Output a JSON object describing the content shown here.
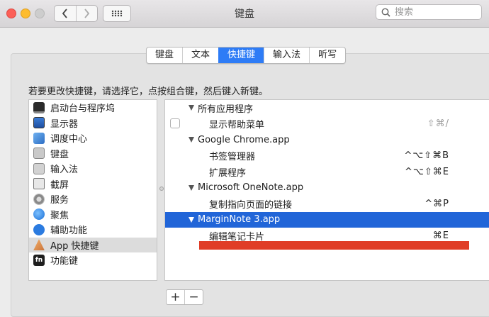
{
  "window": {
    "title": "键盘"
  },
  "search": {
    "placeholder": "搜索"
  },
  "tabs": [
    {
      "label": "键盘",
      "active": false
    },
    {
      "label": "文本",
      "active": false
    },
    {
      "label": "快捷键",
      "active": true
    },
    {
      "label": "输入法",
      "active": false
    },
    {
      "label": "听写",
      "active": false
    }
  ],
  "instruction": "若要更改快捷键，请选择它，点按组合键，然后键入新键。",
  "categories": [
    {
      "label": "启动台与程序坞",
      "icon": "launchpad-dock-icon"
    },
    {
      "label": "显示器",
      "icon": "display-icon"
    },
    {
      "label": "调度中心",
      "icon": "mission-control-icon"
    },
    {
      "label": "键盘",
      "icon": "keyboard-icon"
    },
    {
      "label": "输入法",
      "icon": "input-source-icon"
    },
    {
      "label": "截屏",
      "icon": "screenshot-icon"
    },
    {
      "label": "服务",
      "icon": "services-gear-icon"
    },
    {
      "label": "聚焦",
      "icon": "spotlight-icon"
    },
    {
      "label": "辅助功能",
      "icon": "accessibility-icon"
    },
    {
      "label": "App 快捷键",
      "icon": "app-shortcuts-icon",
      "selected": true
    },
    {
      "label": "功能键",
      "icon": "fn-key-icon",
      "icon_text": "fn"
    }
  ],
  "shortcuts": [
    {
      "type": "group",
      "label": "所有应用程序"
    },
    {
      "type": "item",
      "label": "显示帮助菜单",
      "key": "⇧⌘/",
      "dim": true,
      "checkbox": true
    },
    {
      "type": "group",
      "label": "Google Chrome.app"
    },
    {
      "type": "item",
      "label": "书签管理器",
      "key": "^⌥⇧⌘B"
    },
    {
      "type": "item",
      "label": "扩展程序",
      "key": "^⌥⇧⌘E"
    },
    {
      "type": "group",
      "label": "Microsoft OneNote.app"
    },
    {
      "type": "item",
      "label": "复制指向页面的链接",
      "key": "^⌘P"
    },
    {
      "type": "group",
      "label": "MarginNote 3.app",
      "selected": true
    },
    {
      "type": "item",
      "label": "编辑笔记卡片",
      "key": "⌘E"
    }
  ],
  "buttons": {
    "add": "+",
    "remove": "−"
  },
  "colors": {
    "accent": "#2e7cf6",
    "selection": "#2165d8",
    "redact": "#e03d27"
  }
}
